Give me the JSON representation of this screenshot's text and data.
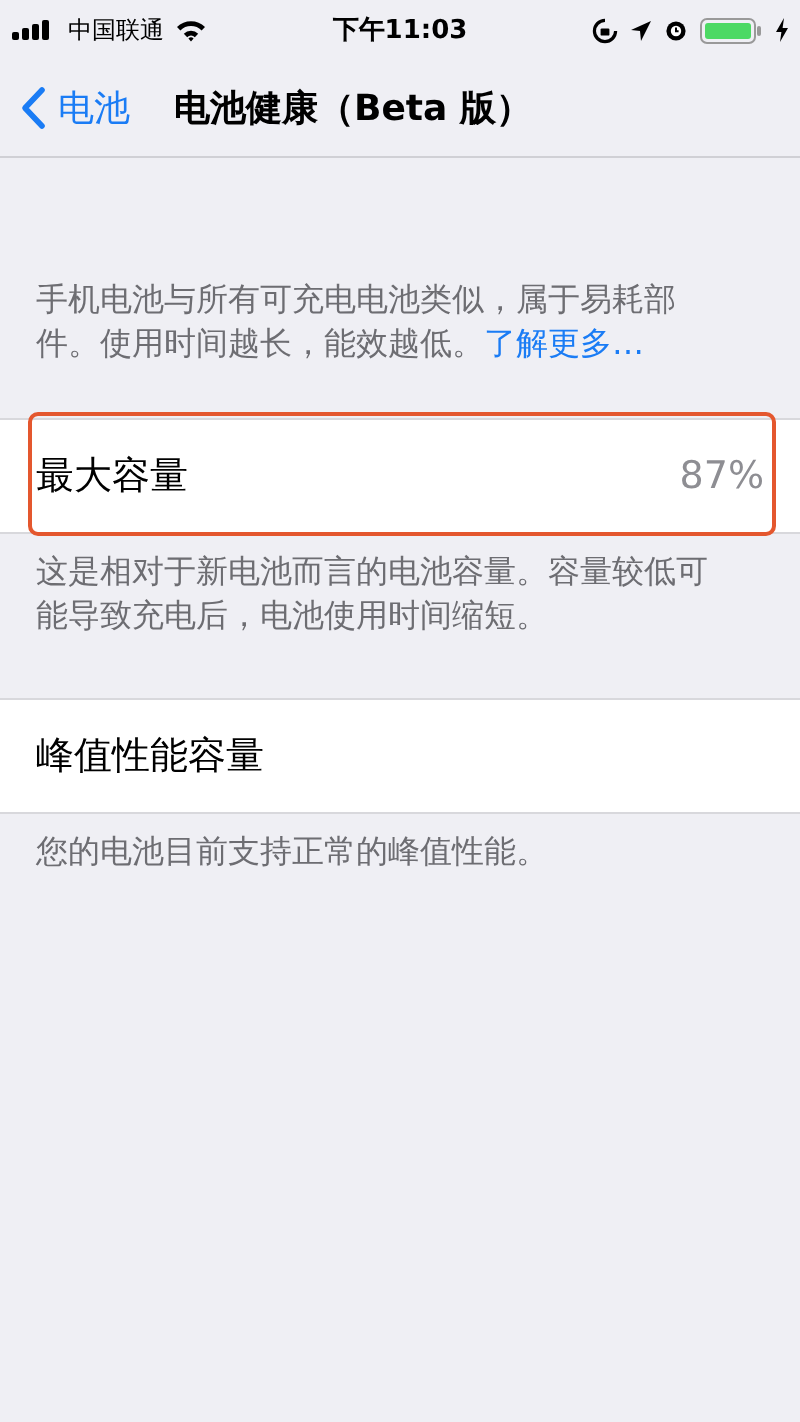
{
  "status_bar": {
    "carrier": "中国联通",
    "time": "下午11:03"
  },
  "nav": {
    "back": "电池",
    "title": "电池健康（Beta 版）"
  },
  "intro": {
    "text": "手机电池与所有可充电电池类似，属于易耗部件。使用时间越长，能效越低。",
    "link": "了解更多…"
  },
  "sections": [
    {
      "label": "最大容量",
      "value": "87%",
      "highlighted": true,
      "footer": "这是相对于新电池而言的电池容量。容量较低可能导致充电后，电池使用时间缩短。"
    },
    {
      "label": "峰值性能容量",
      "highlighted": false,
      "footer": "您的电池目前支持正常的峰值性能。"
    }
  ]
}
